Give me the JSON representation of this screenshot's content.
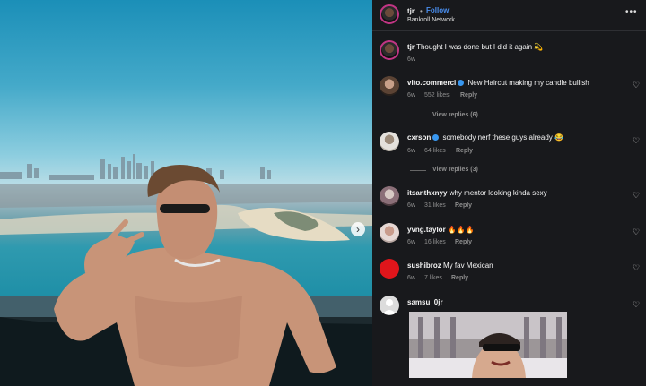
{
  "post": {
    "username": "tjr",
    "separator": "•",
    "follow_label": "Follow",
    "subtitle": "Bankroll Network",
    "more_icon": "more-horizontal-icon",
    "caption_user": "tjr",
    "caption_text": "Thought I was done but I did it again 💫",
    "caption_time": "6w"
  },
  "comments": [
    {
      "user": "vito.commerci",
      "verified": true,
      "text": "New Haircut making my candle bullish",
      "time": "6w",
      "likes": "552 likes",
      "reply": "Reply",
      "view_replies": "View replies (6)"
    },
    {
      "user": "cxrson",
      "verified": true,
      "text": "somebody nerf these guys already 😂",
      "time": "6w",
      "likes": "64 likes",
      "reply": "Reply",
      "view_replies": "View replies (3)"
    },
    {
      "user": "itsanthxnyy",
      "verified": false,
      "text": "why mentor looking kinda sexy",
      "time": "6w",
      "likes": "31 likes",
      "reply": "Reply"
    },
    {
      "user": "yvng.taylor",
      "verified": false,
      "text": "🔥🔥🔥",
      "time": "6w",
      "likes": "16 likes",
      "reply": "Reply"
    },
    {
      "user": "sushibroz",
      "verified": false,
      "text": "My fav Mexican",
      "time": "6w",
      "likes": "7 likes",
      "reply": "Reply"
    },
    {
      "user": "samsu_0jr",
      "verified": false,
      "text": ""
    }
  ],
  "colors": {
    "accent": "#4a8ff0",
    "panel": "#18191c",
    "muted": "#8e8e8e",
    "sushibroz_avatar": "#e0151b"
  }
}
